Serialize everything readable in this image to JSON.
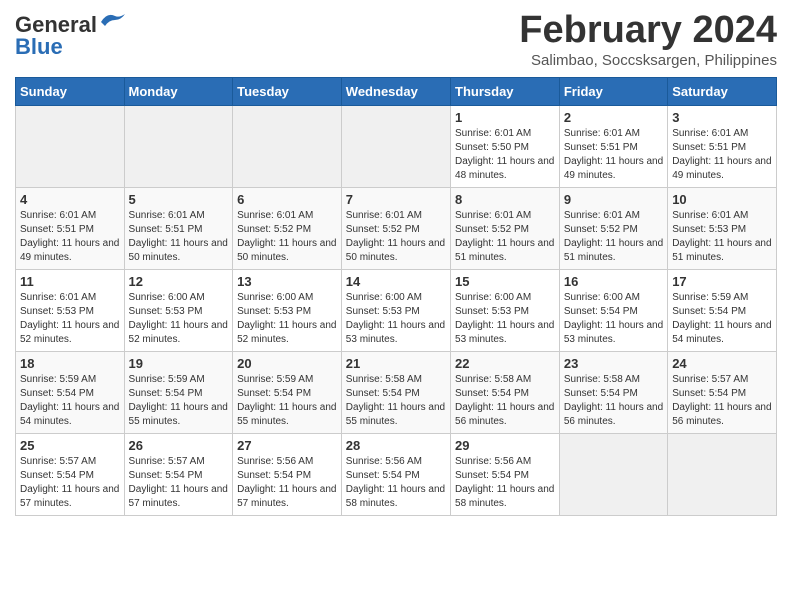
{
  "logo": {
    "general": "General",
    "blue": "Blue"
  },
  "title": "February 2024",
  "subtitle": "Salimbao, Soccsksargen, Philippines",
  "days_of_week": [
    "Sunday",
    "Monday",
    "Tuesday",
    "Wednesday",
    "Thursday",
    "Friday",
    "Saturday"
  ],
  "weeks": [
    [
      {
        "day": "",
        "info": ""
      },
      {
        "day": "",
        "info": ""
      },
      {
        "day": "",
        "info": ""
      },
      {
        "day": "",
        "info": ""
      },
      {
        "day": "1",
        "info": "Sunrise: 6:01 AM\nSunset: 5:50 PM\nDaylight: 11 hours and 48 minutes."
      },
      {
        "day": "2",
        "info": "Sunrise: 6:01 AM\nSunset: 5:51 PM\nDaylight: 11 hours and 49 minutes."
      },
      {
        "day": "3",
        "info": "Sunrise: 6:01 AM\nSunset: 5:51 PM\nDaylight: 11 hours and 49 minutes."
      }
    ],
    [
      {
        "day": "4",
        "info": "Sunrise: 6:01 AM\nSunset: 5:51 PM\nDaylight: 11 hours and 49 minutes."
      },
      {
        "day": "5",
        "info": "Sunrise: 6:01 AM\nSunset: 5:51 PM\nDaylight: 11 hours and 50 minutes."
      },
      {
        "day": "6",
        "info": "Sunrise: 6:01 AM\nSunset: 5:52 PM\nDaylight: 11 hours and 50 minutes."
      },
      {
        "day": "7",
        "info": "Sunrise: 6:01 AM\nSunset: 5:52 PM\nDaylight: 11 hours and 50 minutes."
      },
      {
        "day": "8",
        "info": "Sunrise: 6:01 AM\nSunset: 5:52 PM\nDaylight: 11 hours and 51 minutes."
      },
      {
        "day": "9",
        "info": "Sunrise: 6:01 AM\nSunset: 5:52 PM\nDaylight: 11 hours and 51 minutes."
      },
      {
        "day": "10",
        "info": "Sunrise: 6:01 AM\nSunset: 5:53 PM\nDaylight: 11 hours and 51 minutes."
      }
    ],
    [
      {
        "day": "11",
        "info": "Sunrise: 6:01 AM\nSunset: 5:53 PM\nDaylight: 11 hours and 52 minutes."
      },
      {
        "day": "12",
        "info": "Sunrise: 6:00 AM\nSunset: 5:53 PM\nDaylight: 11 hours and 52 minutes."
      },
      {
        "day": "13",
        "info": "Sunrise: 6:00 AM\nSunset: 5:53 PM\nDaylight: 11 hours and 52 minutes."
      },
      {
        "day": "14",
        "info": "Sunrise: 6:00 AM\nSunset: 5:53 PM\nDaylight: 11 hours and 53 minutes."
      },
      {
        "day": "15",
        "info": "Sunrise: 6:00 AM\nSunset: 5:53 PM\nDaylight: 11 hours and 53 minutes."
      },
      {
        "day": "16",
        "info": "Sunrise: 6:00 AM\nSunset: 5:54 PM\nDaylight: 11 hours and 53 minutes."
      },
      {
        "day": "17",
        "info": "Sunrise: 5:59 AM\nSunset: 5:54 PM\nDaylight: 11 hours and 54 minutes."
      }
    ],
    [
      {
        "day": "18",
        "info": "Sunrise: 5:59 AM\nSunset: 5:54 PM\nDaylight: 11 hours and 54 minutes."
      },
      {
        "day": "19",
        "info": "Sunrise: 5:59 AM\nSunset: 5:54 PM\nDaylight: 11 hours and 55 minutes."
      },
      {
        "day": "20",
        "info": "Sunrise: 5:59 AM\nSunset: 5:54 PM\nDaylight: 11 hours and 55 minutes."
      },
      {
        "day": "21",
        "info": "Sunrise: 5:58 AM\nSunset: 5:54 PM\nDaylight: 11 hours and 55 minutes."
      },
      {
        "day": "22",
        "info": "Sunrise: 5:58 AM\nSunset: 5:54 PM\nDaylight: 11 hours and 56 minutes."
      },
      {
        "day": "23",
        "info": "Sunrise: 5:58 AM\nSunset: 5:54 PM\nDaylight: 11 hours and 56 minutes."
      },
      {
        "day": "24",
        "info": "Sunrise: 5:57 AM\nSunset: 5:54 PM\nDaylight: 11 hours and 56 minutes."
      }
    ],
    [
      {
        "day": "25",
        "info": "Sunrise: 5:57 AM\nSunset: 5:54 PM\nDaylight: 11 hours and 57 minutes."
      },
      {
        "day": "26",
        "info": "Sunrise: 5:57 AM\nSunset: 5:54 PM\nDaylight: 11 hours and 57 minutes."
      },
      {
        "day": "27",
        "info": "Sunrise: 5:56 AM\nSunset: 5:54 PM\nDaylight: 11 hours and 57 minutes."
      },
      {
        "day": "28",
        "info": "Sunrise: 5:56 AM\nSunset: 5:54 PM\nDaylight: 11 hours and 58 minutes."
      },
      {
        "day": "29",
        "info": "Sunrise: 5:56 AM\nSunset: 5:54 PM\nDaylight: 11 hours and 58 minutes."
      },
      {
        "day": "",
        "info": ""
      },
      {
        "day": "",
        "info": ""
      }
    ]
  ]
}
